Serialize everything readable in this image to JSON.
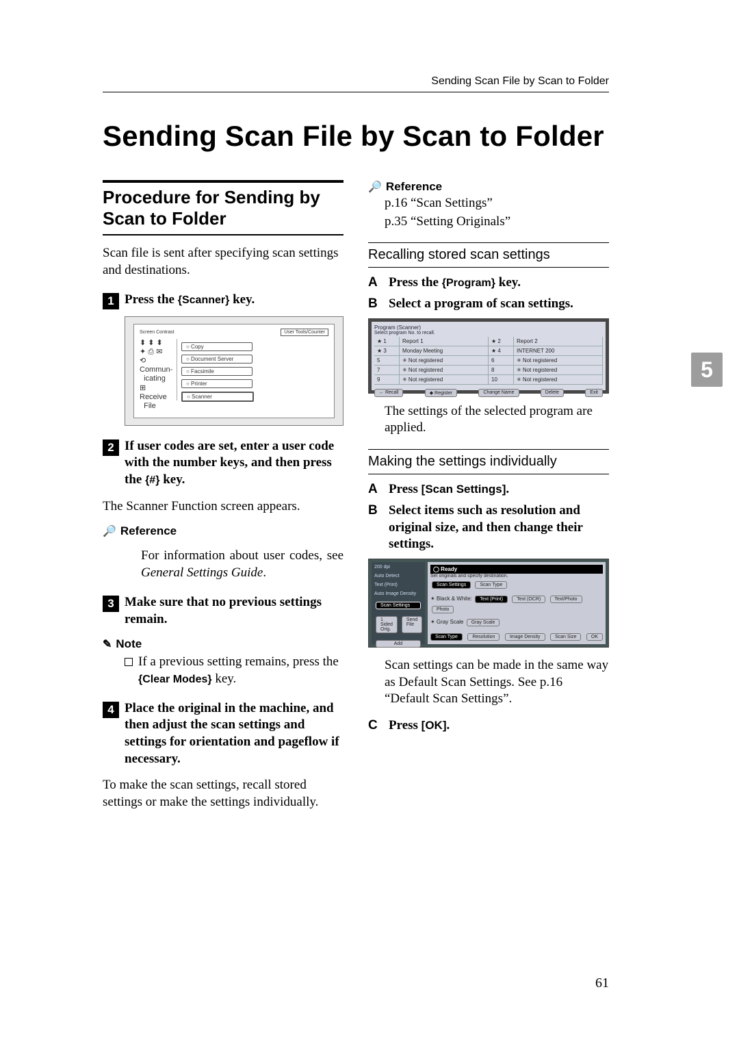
{
  "running_head": "Sending Scan File by Scan to Folder",
  "title": "Sending Scan File by Scan to Folder",
  "section_title": "Procedure for Sending by Scan to Folder",
  "intro": "Scan file is sent after specifying scan settings and destinations.",
  "steps": {
    "1": {
      "pre": "Press the ",
      "key": "{Scanner}",
      "post": " key."
    },
    "2": {
      "pre": "If user codes are set, enter a user code with the number keys, and then press the ",
      "key": "{#}",
      "post": " key."
    },
    "2_followup": "The Scanner Function screen appears.",
    "3": "Make sure that no previous settings remain.",
    "4": "Place the original in the machine, and then adjust the scan settings and settings for orientation and pageflow if necessary.",
    "4_followup": "To make the scan settings, recall stored settings or make the settings individually."
  },
  "ref1": {
    "head": "Reference",
    "body_pre": "For information about user codes, see ",
    "body_ital": "General Settings Guide",
    "body_post": "."
  },
  "note": {
    "head": "Note",
    "body_pre": "If a previous setting remains, press the ",
    "key": "{Clear Modes}",
    "body_post": " key."
  },
  "ref2": {
    "head": "Reference",
    "line1": "p.16 “Scan Settings”",
    "line2": "p.35 “Setting Originals”"
  },
  "recall": {
    "head": "Recalling stored scan settings",
    "A": {
      "pre": "Press the ",
      "key": "{Program}",
      "post": " key."
    },
    "B": "Select a program of scan settings.",
    "after": "The settings of the selected program are applied."
  },
  "indiv": {
    "head": "Making the settings individually",
    "A": {
      "pre": "Press ",
      "ui": "[Scan Settings]",
      "post": "."
    },
    "B": "Select items such as resolution and original size, and then change their settings.",
    "after": "Scan settings can be made in the same way as Default Scan Settings. See p.16 “Default Scan Settings”.",
    "C": {
      "pre": "Press ",
      "ui": "[OK]",
      "post": "."
    }
  },
  "fig1": {
    "contrast": "Screen Contrast",
    "usertools": "User Tools/Counter",
    "copy": "○ Copy",
    "doc": "○ Document Server",
    "fax": "○ Facsimile",
    "prn": "○ Printer",
    "scn": "○ Scanner"
  },
  "ss1": {
    "title": "Program (Scanner)",
    "sub": "Select program No. to recall.",
    "r1a": "★ 1",
    "r1b": "Report 1",
    "r1c": "★ 2",
    "r1d": "Report 2",
    "r2a": "★ 3",
    "r2b": "Monday Meeting",
    "r2c": "★ 4",
    "r2d": "INTERNET 200",
    "r3a": "5",
    "r3b": "✳ Not registered",
    "r3c": "6",
    "r3d": "✳ Not registered",
    "r4a": "7",
    "r4b": "✳ Not registered",
    "r4c": "8",
    "r4d": "✳ Not registered",
    "r5a": "9",
    "r5b": "✳ Not registered",
    "r5c": "10",
    "r5d": "✳ Not registered",
    "b1": "← Recall",
    "b2": "◆ Register",
    "b3": "Change Name",
    "b4": "Delete",
    "b5": "Exit"
  },
  "ss2": {
    "left1": "200 dpi",
    "left2": "Auto Detect",
    "left3": "Text (Print)",
    "left4": "Auto Image Density",
    "tab1": "Scan Settings",
    "tab2": "1 Sided Orig.",
    "tab3": "Send File",
    "add": "Add",
    "ready": "◯ Ready",
    "readysub": "Set originals and specify destination.",
    "tabA": "Scan Settings",
    "tabB": "Scan Type",
    "opt1": "✶ Black & White:",
    "chip1": "Text (Print)",
    "chip2": "Text (OCR)",
    "chip3": "Text/Photo",
    "chip4": "Photo",
    "opt2": "✶ Gray Scale",
    "chip5": "Gray Scale",
    "botScanType": "Scan Type",
    "botRes": "Resolution",
    "botDen": "Image Density",
    "botSize": "Scan Size",
    "botOK": "OK"
  },
  "chapter": "5",
  "pagenum": "61"
}
